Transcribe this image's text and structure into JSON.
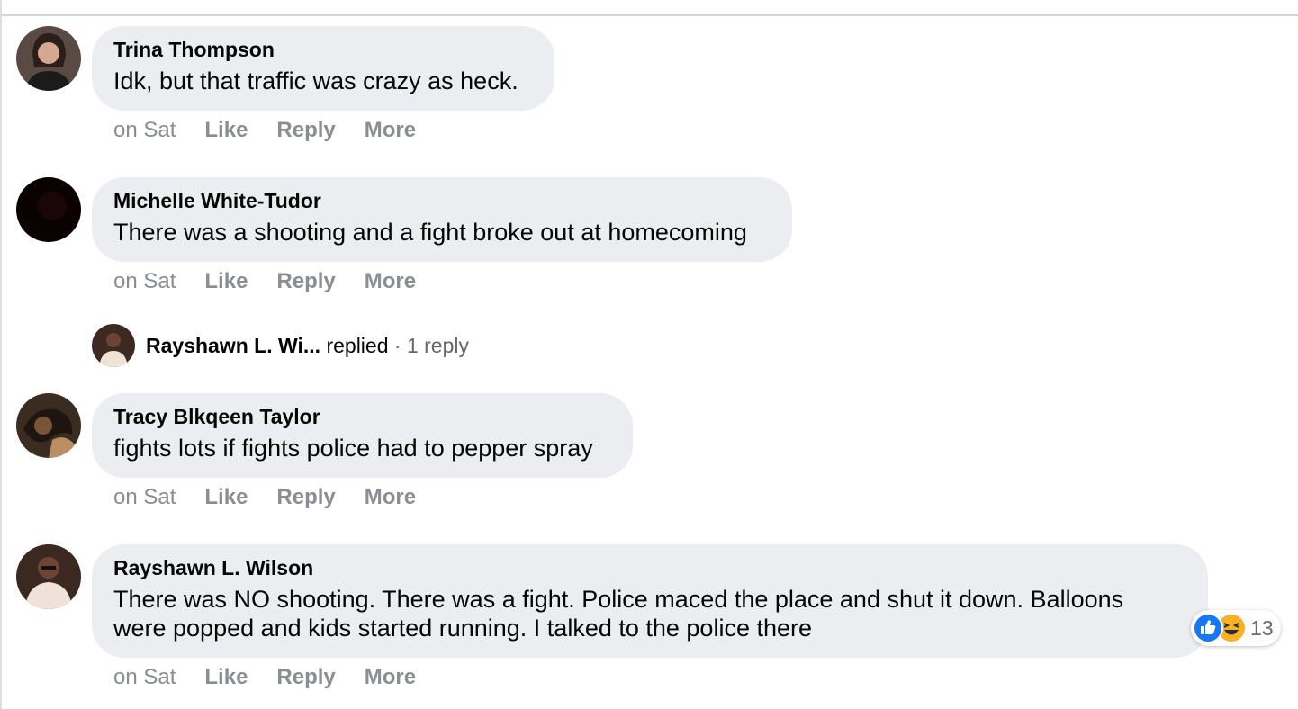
{
  "comments": [
    {
      "author": "Trina Thompson",
      "text": "Idk, but that traffic was crazy as heck.",
      "time": "on Sat",
      "like": "Like",
      "reply": "Reply",
      "more": "More"
    },
    {
      "author": "Michelle White-Tudor",
      "text": "There was a shooting and a fight broke out at homecoming",
      "time": "on Sat",
      "like": "Like",
      "reply": "Reply",
      "more": "More"
    },
    {
      "author": "Tracy Blkqeen Taylor",
      "text": "fights lots if fights police had to pepper spray",
      "time": "on Sat",
      "like": "Like",
      "reply": "Reply",
      "more": "More"
    },
    {
      "author": "Rayshawn L. Wilson",
      "text_line1": "There was NO shooting. There was a fight. Police maced the place and shut it down. Balloons",
      "text_line2": "were popped and kids started running. I talked to the police there",
      "time": "on Sat",
      "like": "Like",
      "reply": "Reply",
      "more": "More",
      "reactions": {
        "count": "13",
        "types": [
          "like-icon",
          "haha-icon"
        ]
      }
    }
  ],
  "reply_preview": {
    "name": "Rayshawn L. Wi...",
    "action": " replied",
    "count": " · 1 reply"
  },
  "colors": {
    "bubble": "#ebedf0",
    "meta_text": "#8a8d91",
    "like_blue": "#1877f2",
    "haha_yellow": "#f7b125"
  }
}
